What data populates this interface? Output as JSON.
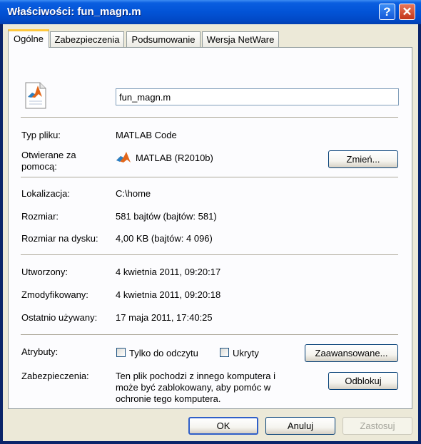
{
  "window": {
    "title": "Właściwości: fun_magn.m"
  },
  "tabs": [
    {
      "label": "Ogólne",
      "active": true
    },
    {
      "label": "Zabezpieczenia"
    },
    {
      "label": "Podsumowanie"
    },
    {
      "label": "Wersja NetWare"
    }
  ],
  "file": {
    "name": "fun_magn.m",
    "icon": "matlab-file-icon"
  },
  "type": {
    "label": "Typ pliku:",
    "value": "MATLAB Code"
  },
  "opens_with": {
    "label": "Otwierane za pomocą:",
    "app": "MATLAB (R2010b)",
    "icon": "matlab-icon",
    "change_button": "Zmień..."
  },
  "location": {
    "label": "Lokalizacja:",
    "value": "C:\\home"
  },
  "size": {
    "label": "Rozmiar:",
    "value": "581 bajtów (bajtów: 581)"
  },
  "size_on_disk": {
    "label": "Rozmiar na dysku:",
    "value": "4,00 KB (bajtów: 4 096)"
  },
  "created": {
    "label": "Utworzony:",
    "value": "4 kwietnia 2011, 09:20:17"
  },
  "modified": {
    "label": "Zmodyfikowany:",
    "value": "4 kwietnia 2011, 09:20:18"
  },
  "accessed": {
    "label": "Ostatnio używany:",
    "value": "17 maja 2011, 17:40:25"
  },
  "attributes": {
    "label": "Atrybuty:",
    "readonly": "Tylko do odczytu",
    "hidden": "Ukryty",
    "advanced_button": "Zaawansowane..."
  },
  "security": {
    "label": "Zabezpieczenia:",
    "text_line1": "Ten plik pochodzi z innego komputera i",
    "text_line2": "może być zablokowany, aby pomóc w",
    "text_line3": "ochronie tego komputera.",
    "unblock_button": "Odblokuj"
  },
  "buttons": {
    "ok": "OK",
    "cancel": "Anuluj",
    "apply": "Zastosuj"
  },
  "colors": {
    "titlebar": "#0253d6",
    "tab_highlight": "#ffc83c",
    "dialog_bg": "#ece9d8"
  }
}
